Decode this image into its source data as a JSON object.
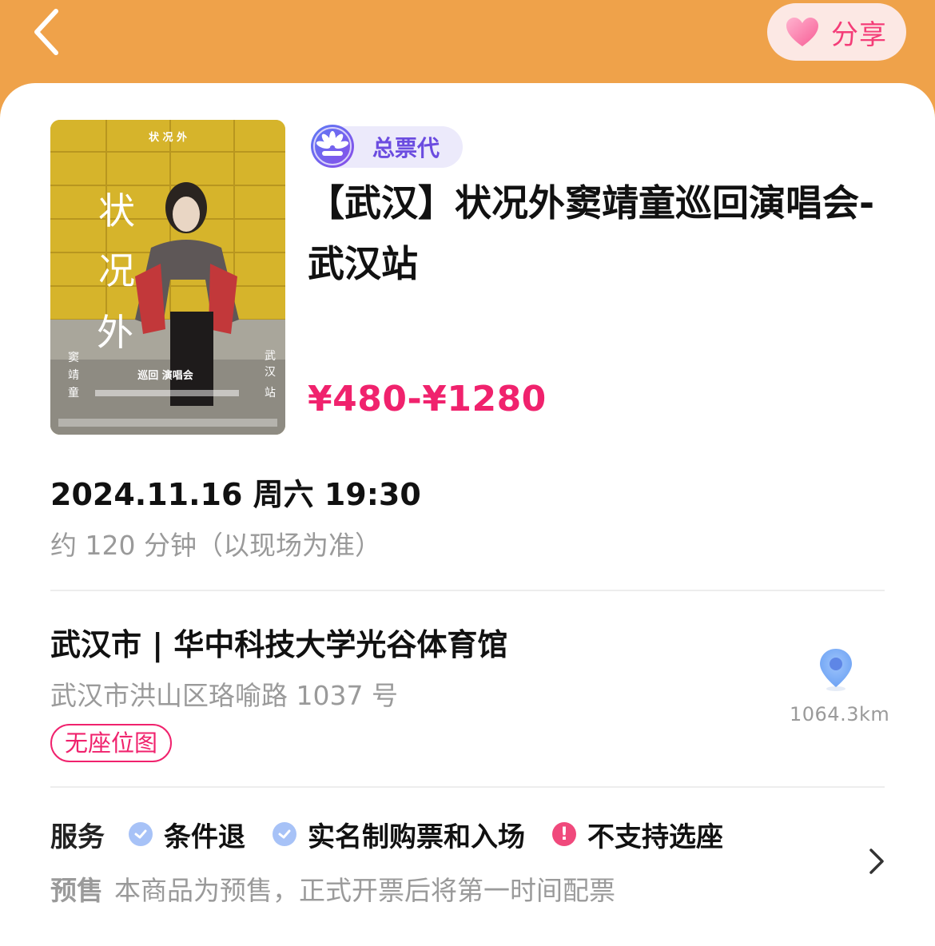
{
  "header": {
    "share_label": "分享"
  },
  "poster": {
    "top_text": "状 况 外",
    "big_title": [
      "状",
      "况",
      "外"
    ],
    "artist_vertical": [
      "窦",
      "靖",
      "童"
    ],
    "station_vertical": [
      "武",
      "汉",
      "站"
    ],
    "subtitle": "巡回 演唱会"
  },
  "event": {
    "agent_badge": "总票代",
    "title": "【武汉】状况外窦靖童巡回演唱会-武汉站",
    "price": "¥480-¥1280",
    "datetime": "2024.11.16 周六 19:30",
    "duration": "约 120 分钟（以现场为准）"
  },
  "venue": {
    "name": "武汉市 | 华中科技大学光谷体育馆",
    "address": "武汉市洪山区珞喻路 1037 号",
    "seat_tag": "无座位图",
    "distance": "1064.3km"
  },
  "services": {
    "title": "服务",
    "items": [
      {
        "label": "条件退",
        "status": "check"
      },
      {
        "label": "实名制购票和入场",
        "status": "check"
      },
      {
        "label": "不支持选座",
        "status": "warn"
      }
    ],
    "presale_title": "预售",
    "presale_text": "本商品为预售，正式开票后将第一时间配票"
  },
  "colors": {
    "header_bg": "#EFA24A",
    "accent_pink": "#F0226D",
    "agent_purple": "#6B4CE0",
    "check_blue": "#A7C2F7"
  }
}
